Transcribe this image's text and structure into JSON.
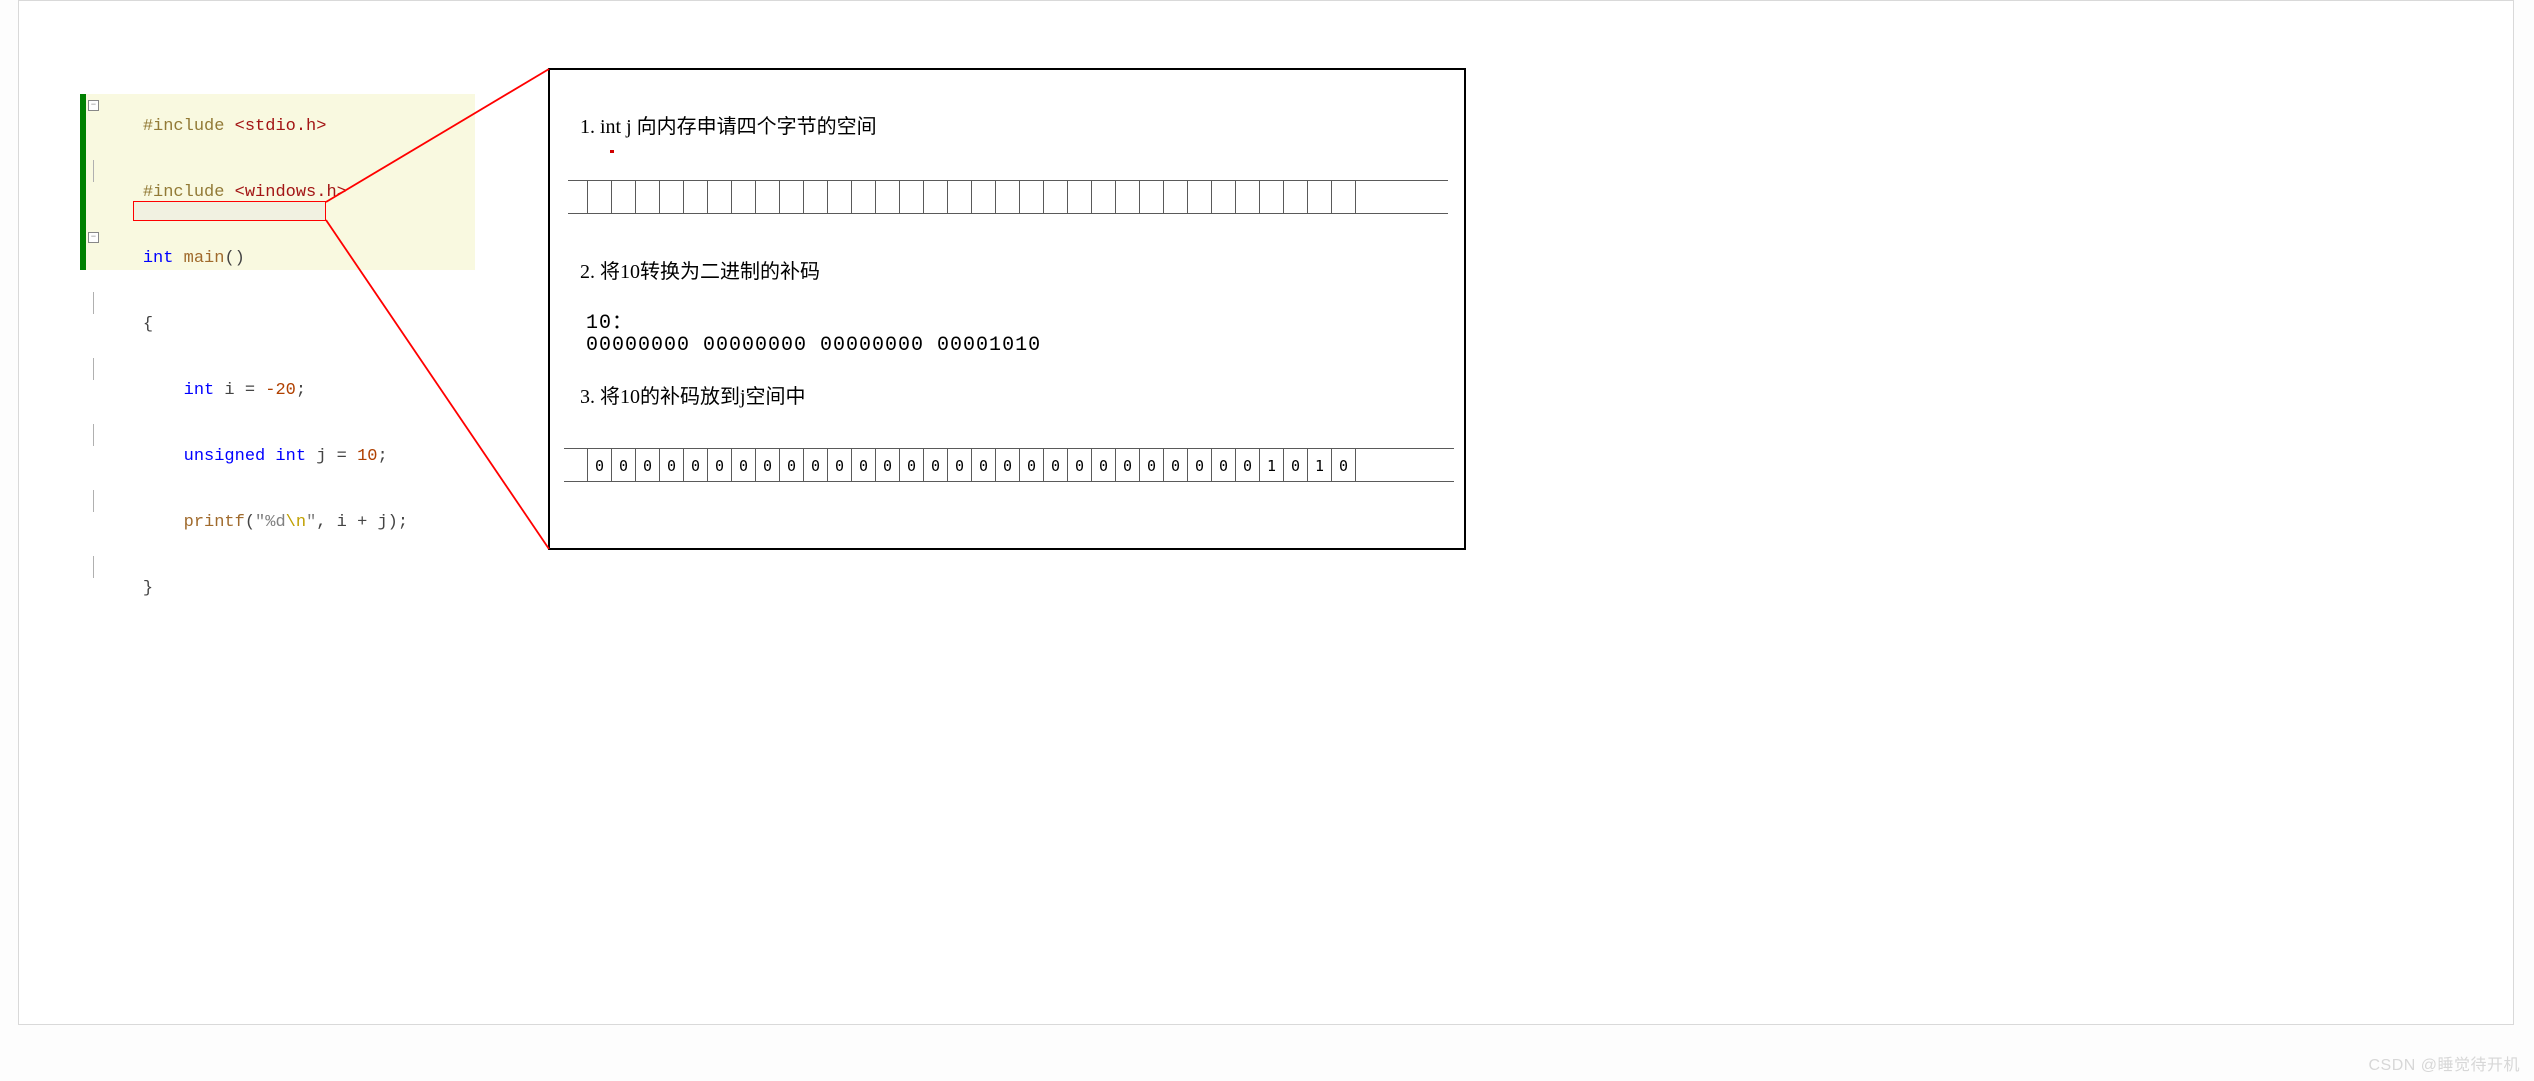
{
  "code": {
    "l1_pp": "#include",
    "l1_inc": " <stdio.h>",
    "l2_pp": "#include",
    "l2_inc": " <windows.h>",
    "l3_type": "int",
    "l3_fn": " main",
    "l3_paren": "()",
    "l4": "{",
    "l5_type": "    int",
    "l5_rest": " i = ",
    "l5_num": "-20",
    "l5_semi": ";",
    "l6_type": "    unsigned int",
    "l6_rest": " j = ",
    "l6_num": "10",
    "l6_semi": ";",
    "l7_fn": "    printf",
    "l7_open": "(",
    "l7_strq1": "\"",
    "l7_strbody": "%d",
    "l7_esc": "\\n",
    "l7_strq2": "\"",
    "l7_rest": ", i + j);",
    "l8": "}"
  },
  "explain": {
    "h1": "1. int j 向内存申请四个字节的空间",
    "h2": "2. 将10转换为二进制的补码",
    "ten_label": "10：",
    "ten_bits": "00000000 00000000 00000000 00001010",
    "h3": "3. 将10的补码放到j空间中",
    "bits_filled": [
      "0",
      "0",
      "0",
      "0",
      "0",
      "0",
      "0",
      "0",
      "0",
      "0",
      "0",
      "0",
      "0",
      "0",
      "0",
      "0",
      "0",
      "0",
      "0",
      "0",
      "0",
      "0",
      "0",
      "0",
      "0",
      "0",
      "0",
      "0",
      "1",
      "0",
      "1",
      "0"
    ]
  },
  "watermark": "CSDN @睡觉待开机"
}
